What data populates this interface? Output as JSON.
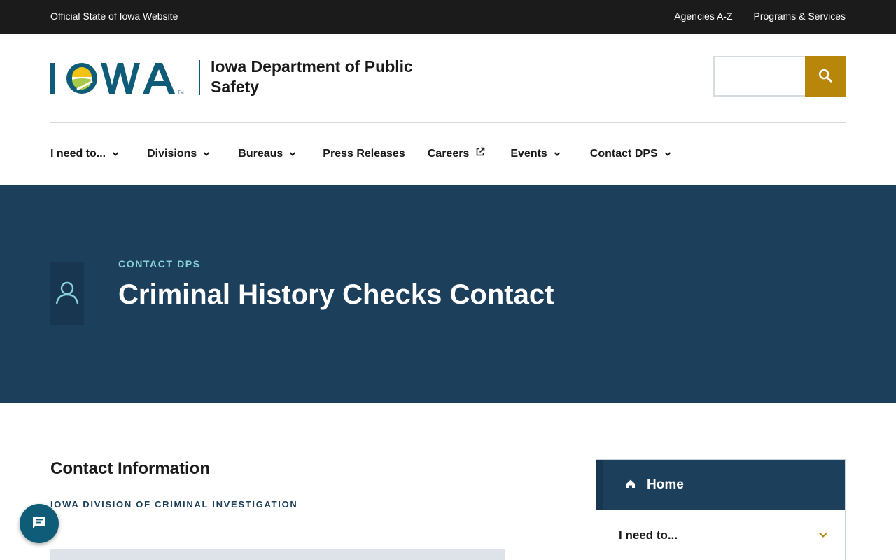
{
  "utility": {
    "official_text": "Official State of Iowa Website",
    "links": [
      "Agencies A-Z",
      "Programs & Services"
    ]
  },
  "header": {
    "logo_text": "IOWA",
    "agency_name": "Iowa Department of Public Safety",
    "search_placeholder": ""
  },
  "nav": {
    "items": [
      {
        "label": "I need to...",
        "icon": "chevron-down-icon"
      },
      {
        "label": "Divisions",
        "icon": "chevron-down-icon"
      },
      {
        "label": "Bureaus",
        "icon": "chevron-down-icon"
      },
      {
        "label": "Press Releases",
        "icon": ""
      },
      {
        "label": "Careers",
        "icon": "external-link-icon"
      },
      {
        "label": "Events",
        "icon": "chevron-down-icon"
      },
      {
        "label": "Contact DPS",
        "icon": "chevron-down-icon"
      }
    ]
  },
  "hero": {
    "eyebrow": "CONTACT DPS",
    "title": "Criminal History Checks Contact",
    "icon": "person-icon"
  },
  "content": {
    "heading": "Contact Information",
    "subheading": "IOWA DIVISION OF CRIMINAL INVESTIGATION"
  },
  "side_nav": {
    "home_label": "Home",
    "items": [
      {
        "label": "I need to...",
        "icon": "chevron-down-icon"
      }
    ]
  },
  "colors": {
    "utility_bg": "#1b1b1b",
    "hero_bg": "#1c3f5b",
    "search_button": "#b8860b",
    "accent_teal": "#88d3d9",
    "chat_button": "#0e5c78"
  }
}
